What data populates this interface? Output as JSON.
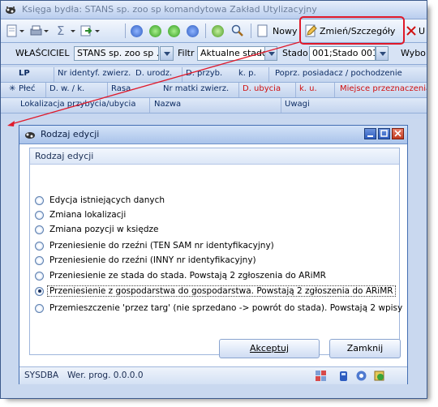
{
  "window": {
    "title": "Księga bydła: STANS sp. zoo sp komandytowa Zakład Utylizacyjny"
  },
  "toolbar": {
    "new_label": "Nowy",
    "edit_label": "Zmień/Szczegóły",
    "cut_label": "U"
  },
  "filterbar": {
    "owner_label": "WŁAŚCICIEL",
    "owner_value": "STANS sp. zoo sp ...",
    "owner_btn": "...",
    "filter_label": "Filtr",
    "filter_value": "Aktualne stado",
    "herd_label": "Stado",
    "herd_value": "001;Stado 001",
    "select_label": "Wybo"
  },
  "grid": {
    "row1": [
      "LP",
      "Nr identyf. zwierz.",
      "D. urodz.",
      "D. przyb.",
      "k. p.",
      "Poprz. posiadacz / pochodzenie"
    ],
    "row2_marker": "✳",
    "row2": [
      "Płeć",
      "D. w. / k.",
      "Rasa",
      "Nr matki zwierz.",
      "D. ubycia",
      "k. u.",
      "Miejsce przeznaczenia"
    ],
    "row3": [
      "Lokalizacja przybycia/ubycia",
      "Nazwa",
      "Uwagi"
    ]
  },
  "dialog": {
    "title": "Rodzaj edycji",
    "group_title": "Rodzaj edycji",
    "options": [
      {
        "label": "Edycja istniejących danych",
        "selected": false
      },
      {
        "label": "Zmiana lokalizacji",
        "selected": false
      },
      {
        "label": "Zmiana pozycji w księdze",
        "selected": false
      },
      {
        "label": "Przeniesienie do rzeźni (TEN SAM nr identyfikacyjny)",
        "selected": false
      },
      {
        "label": "Przeniesienie do rzeźni (INNY nr identyfikacyjny)",
        "selected": false
      },
      {
        "label": "Przeniesienie ze stada do stada. Powstają 2 zgłoszenia do ARiMR",
        "selected": false
      },
      {
        "label": "Przeniesienie z gospodarstwa do gospodarstwa. Powstają 2 zgłoszenia do ARiMR",
        "selected": true
      },
      {
        "label": "Przemieszczenie 'przez targ' (nie sprzedano -> powrót do stada). Powstają 2 wpisy",
        "selected": false
      }
    ],
    "accept_label": "Akceptuj",
    "close_label": "Zamknij",
    "status": {
      "user": "SYSDBA",
      "version": "Wer. prog. 0.0.0.0"
    }
  },
  "colors": {
    "annotation": "#e0192a",
    "accent": "#2d5cc0"
  }
}
